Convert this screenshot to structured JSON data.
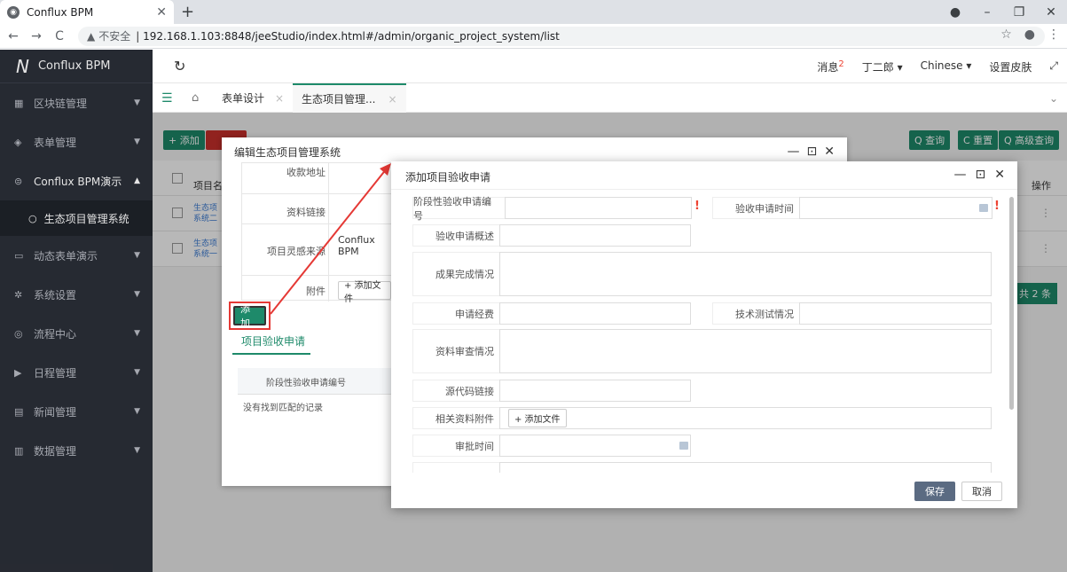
{
  "browser": {
    "tab_title": "Conflux BPM",
    "insecure_label": "不安全",
    "url": "192.168.1.103:8848/jeeStudio/index.html#/admin/organic_project_system/list"
  },
  "app": {
    "brand": "Conflux BPM",
    "sidebar": [
      {
        "icon": "▦",
        "label": "区块链管理",
        "caret": "▼"
      },
      {
        "icon": "◈",
        "label": "表单管理",
        "caret": "▼"
      },
      {
        "icon": "⊜",
        "label": "Conflux BPM演示",
        "caret": "▲"
      },
      {
        "icon": "▭",
        "label": "动态表单演示",
        "caret": "▼"
      },
      {
        "icon": "✲",
        "label": "系统设置",
        "caret": "▼"
      },
      {
        "icon": "◎",
        "label": "流程中心",
        "caret": "▼"
      },
      {
        "icon": "▶",
        "label": "日程管理",
        "caret": "▼"
      },
      {
        "icon": "▤",
        "label": "新闻管理",
        "caret": "▼"
      },
      {
        "icon": "▥",
        "label": "数据管理",
        "caret": "▼"
      }
    ],
    "submenu_item": "生态项目管理系统",
    "topbar": {
      "messages": "消息",
      "message_count": "2",
      "user": "丁二郎 ▾",
      "language": "Chinese ▾",
      "skin": "设置皮肤"
    },
    "tabs": [
      {
        "label": "表单设计"
      },
      {
        "label": "生态项目管理..."
      }
    ],
    "list": {
      "add": "+ 添加",
      "query": "Q 查询",
      "reset": "C 重置",
      "advanced": "Q 高级查询",
      "col_project": "项目名",
      "col_ops": "操作",
      "row1": "生态项 系统二",
      "row2": "生态项 系统一",
      "total": "共 2 条"
    }
  },
  "dialog1": {
    "title": "编辑生态项目管理系统",
    "rows": [
      {
        "label": "收款地址"
      },
      {
        "label": "资料链接"
      },
      {
        "label": "项目灵感来源",
        "value": "Conflux BPM"
      },
      {
        "label": "附件"
      }
    ],
    "add_file": "+ 添加文件",
    "add_button": "添加",
    "subtab": "项目验收申请",
    "sub_col": "阶段性验收申请编号",
    "empty": "没有找到匹配的记录"
  },
  "dialog2": {
    "title": "添加项目验收申请",
    "fields": {
      "stage_no": "阶段性验收申请编号",
      "apply_time": "验收申请时间",
      "summary": "验收申请概述",
      "result": "成果完成情况",
      "fee": "申请经费",
      "tech_test": "技术测试情况",
      "review": "资料审查情况",
      "source_link": "源代码链接",
      "attachment": "相关资料附件",
      "approve_time": "审批时间"
    },
    "required_mark": "!",
    "add_file": "+ 添加文件",
    "save": "保存",
    "cancel": "取消"
  }
}
